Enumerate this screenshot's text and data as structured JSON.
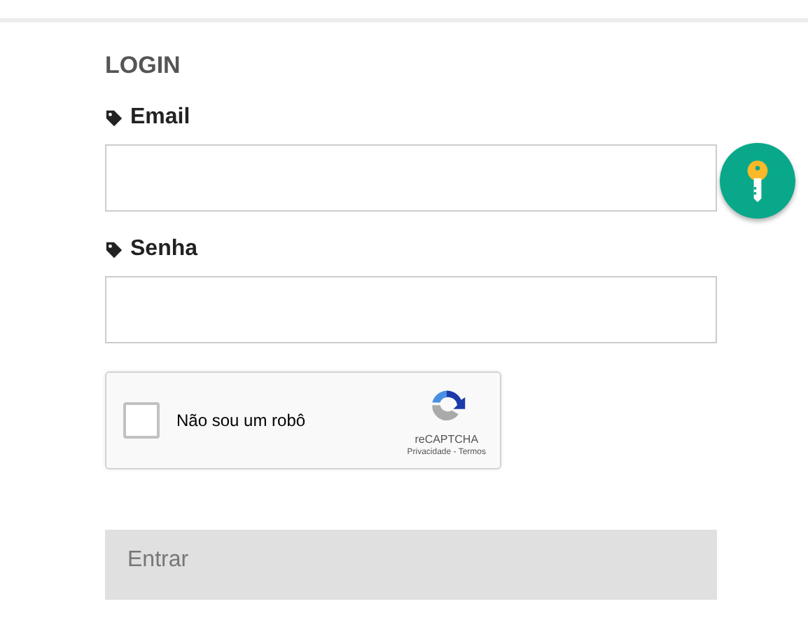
{
  "title": "LOGIN",
  "fields": [
    {
      "label": "Email"
    },
    {
      "label": "Senha"
    }
  ],
  "captcha": {
    "label": "Não sou um robô",
    "checked": false,
    "brand": "reCAPTCHA",
    "links": "Privacidade - Termos"
  },
  "submit": {
    "label": "Entrar",
    "disabled": true
  }
}
